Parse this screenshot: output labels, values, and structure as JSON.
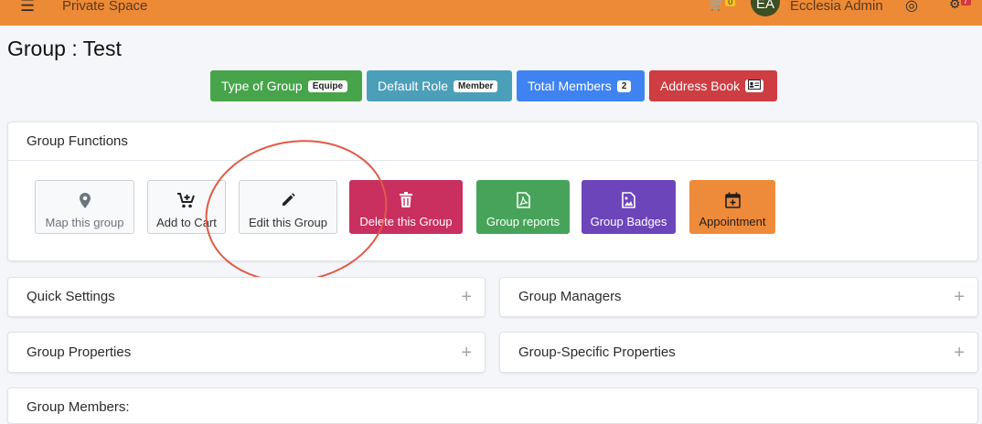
{
  "topbar": {
    "menu_icon": "hamburger-icon",
    "brand": "Private Space",
    "cart_count": "0",
    "avatar_initials": "EA",
    "user_name": "Ecclesia Admin",
    "settings_count": "7"
  },
  "page": {
    "title": "Group : Test"
  },
  "info_buttons": [
    {
      "label": "Type of Group",
      "value": "Equipe",
      "color": "#47a44b"
    },
    {
      "label": "Default Role",
      "value": "Member",
      "color": "#4c9fb9"
    },
    {
      "label": "Total Members",
      "value": "2",
      "color": "#3f83f3"
    },
    {
      "label": "Address Book",
      "value": "",
      "color": "#cd3d42"
    }
  ],
  "group_functions": {
    "title": "Group Functions",
    "buttons": [
      {
        "label": "Map this group",
        "icon": "map-marker-icon"
      },
      {
        "label": "Add to Cart",
        "icon": "cart-plus-icon"
      },
      {
        "label": "Edit this Group",
        "icon": "pencil-icon"
      },
      {
        "label": "Delete this Group",
        "icon": "trash-icon",
        "color": "#c9305f"
      },
      {
        "label": "Group reports",
        "icon": "pdf-file-icon",
        "color": "#47a35a"
      },
      {
        "label": "Group Badges",
        "icon": "image-file-icon",
        "color": "#6d45bb"
      },
      {
        "label": "Appointment",
        "icon": "calendar-plus-icon",
        "color": "#ee8b3a"
      }
    ]
  },
  "panels": {
    "quick_settings": "Quick Settings",
    "group_managers": "Group Managers",
    "group_properties": "Group Properties",
    "group_specific_properties": "Group-Specific Properties",
    "group_members": "Group Members:"
  },
  "colors": {
    "topbar": "#ed8a36",
    "annotation": "#e05a48"
  }
}
